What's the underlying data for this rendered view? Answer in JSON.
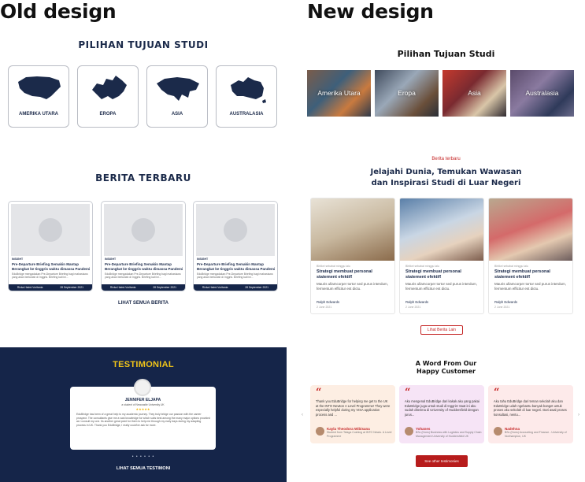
{
  "labels": {
    "old": "Old design",
    "new": "New design"
  },
  "old": {
    "destinations_title": "PILIHAN TUJUAN STUDI",
    "destinations": [
      "AMERIKA UTARA",
      "EROPA",
      "ASIA",
      "AUSTRALASIA"
    ],
    "news_title": "BERITA TERBARU",
    "news": [
      {
        "category": "INSIGHT",
        "title": "Pre-Departure Briefing Semakin Mantap Berangkat ke tinggris waktu dimassa Pandemi",
        "excerpt": "EduBridge mengadakan Pre-Departure Briefing bagi mahasiswa yang akan berkuliah di Inggris. Briefing kali ini...",
        "author": "Rivka Hatmi Vuritania",
        "date": "28 September 2021"
      },
      {
        "category": "INSIGHT",
        "title": "Pre-Departure Briefing Semakin Mantap Berangkat ke tinggris waktu dimassa Pandemi",
        "excerpt": "EduBridge mengadakan Pre-Departure Briefing bagi mahasiswa yang akan berkuliah di Inggris. Briefing kali ini...",
        "author": "Rivka Hatmi Vuritania",
        "date": "28 September 2021"
      },
      {
        "category": "INSIGHT",
        "title": "Pre-Departure Briefing Semakin Mantap Berangkat ke tinggris waktu dimassa Pandemi",
        "excerpt": "EduBridge mengadakan Pre-Departure Briefing bagi mahasiswa yang akan berkuliah di Inggris. Briefing kali ini...",
        "author": "Rivka Hatmi Vuritania",
        "date": "28 September 2021"
      }
    ],
    "news_link": "LIHAT SEMUA BERITA",
    "testimonial_title": "TESTIMONIAL",
    "testimonial": {
      "name": "JENNIFER ELJAPA",
      "subtitle": "a student of Newcastle University UK",
      "stars": "★★★★★",
      "text": "EduBridge has been of a great help to my academic journey. They truly bridge our passion with the career prospect. The consultants give me a vast knowledge for which suits best among the many major options provided as I consult my one. Its another great point for them to help me through my early days during my adapting process in UK. Thank you EduBridge, I really could've ask for more."
    },
    "dots": "• • • • • •",
    "testimonial_link": "LIHAT SEMUA TESTIMONI"
  },
  "new": {
    "destinations_title": "Pilihan Tujuan Studi",
    "destinations": [
      "Amerika Utara",
      "Eropa",
      "Asia",
      "Australasia"
    ],
    "kicker": "Berita terbaru",
    "news_heading_1": "Jelajahi Dunia, Temukan Wawasan",
    "news_heading_2": "dan Inspirasi Studi di Luar Negeri",
    "news": [
      {
        "meta": "Blrtikel sebabat minggu lalu",
        "title": "Strategi membuat personal statement efektif!",
        "excerpt": "Mauris ullamcorper tortor sed purus interdum, fermentum efficitur est dictu.",
        "author": "Ralph Edwards",
        "date": "2 June 2021"
      },
      {
        "meta": "Blrtikel sebabat minggu lalu",
        "title": "Strategi membuat personal statement efektif!",
        "excerpt": "Mauris ullamcorper tortor sed purus interdum, fermentum efficitur est dictu.",
        "author": "Ralph Edwards",
        "date": "2 June 2021"
      },
      {
        "meta": "Blrtikel sebabat minggu lalu",
        "title": "Strategi membuat personal statement efektif!",
        "excerpt": "Mauris ullamcorper tortor sed purus interdum, fermentum efficitur est dictu.",
        "author": "Ralph Edwards",
        "date": "2 June 2021"
      }
    ],
    "news_button": "Lihat Berita Lain",
    "word_head_1": "A Word From Our",
    "word_head_2": "Happy Customer",
    "testimonials": [
      {
        "text": "Thank you EduBridge for helping me get to the UK at the INTO Newton A Level Programme! They were especially helpful during my VISA application process and ...",
        "name": "Kayla Theodora Wibisana",
        "desc": "Student from Telaga Cushing at INTO Newto. A Level Programme"
      },
      {
        "text": "Aku mengenal EduBridge dari kakak aku yang pakai EduBridge juga untuk studi di Inggris! Saat ini aku sudah diterima di University of Huddersfield dengan jurus...",
        "name": "Yohanes",
        "desc": "BSc (Hons) Business with Logistics and Supply Chain Management University of Huddersfield UK"
      },
      {
        "text": "Aku tahu EduBridge dari teman sekolah aku dan EduBridge udah ngebantu banyak banget untuk proses aku sekolah di luar negeri. Dari awal proses konsultasi, nentu...",
        "name": "Nadehna",
        "desc": "BSc (Hons) Accounting and Finance - University of Northampton, UK"
      }
    ],
    "testimonial_button": "See other testimonies"
  },
  "colors": {
    "navy": "#152549",
    "gold": "#f0c419",
    "red": "#c62828"
  }
}
